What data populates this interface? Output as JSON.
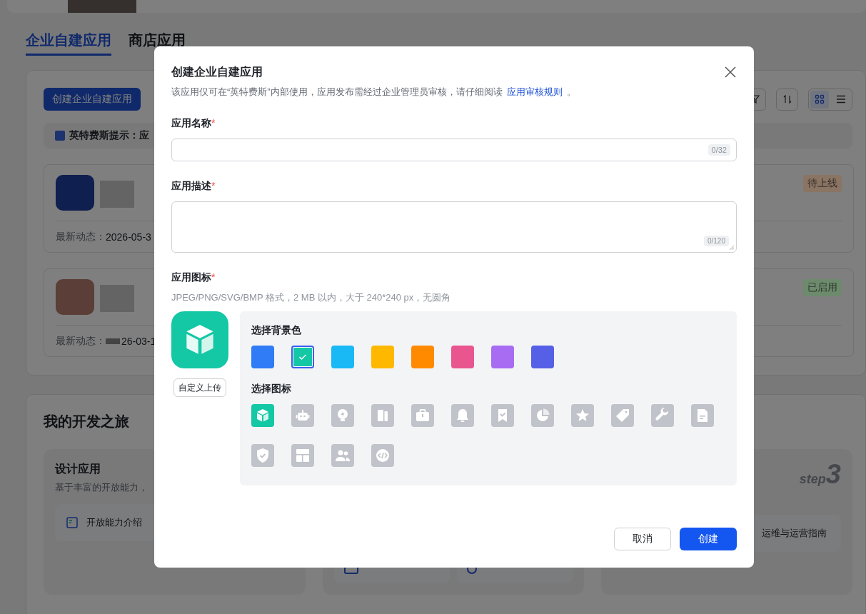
{
  "page": {
    "tabs": [
      {
        "label": "企业自建应用",
        "selected": true
      },
      {
        "label": "商店应用",
        "selected": false
      }
    ],
    "create_button": "创建企业自建应用",
    "view_modes": [
      {
        "selected": true
      },
      {
        "selected": false
      }
    ],
    "notice": "英特费斯提示：应",
    "apps": [
      {
        "status": "待上线",
        "color": "#8a7464",
        "activity_label": "最新动态：",
        "activity_time": "2026-05-3",
        "time_partly_blurred": false
      },
      {
        "status": "已启用",
        "color": "#6d8a6d",
        "activity_label": "最新动态：",
        "activity_time": "26-03-1",
        "time_partly_blurred": true
      }
    ],
    "journey": {
      "title": "我的开发之旅",
      "steps": [
        {
          "title": "设计应用",
          "description": "基于丰富的开放能力，",
          "link": "开放能力介绍",
          "covered": false
        },
        {
          "covered": true
        },
        {
          "step_label": "step",
          "step_number": "3",
          "link": "运维与运营指南",
          "covered": false
        }
      ]
    }
  },
  "dialog": {
    "title": "创建企业自建应用",
    "intro": "该应用仅可在“英特费斯”内部使用，应用发布需经过企业管理员审核，请仔细阅读",
    "intro_link": "应用审核规则",
    "intro_end": "。",
    "name_field": {
      "label": "应用名称",
      "required_mark": "*",
      "counter": "0/32"
    },
    "description_field": {
      "label": "应用描述",
      "required_mark": "*",
      "counter": "0/120"
    },
    "icon_field": {
      "label": "应用图标",
      "required_mark": "*",
      "hint": "JPEG/PNG/SVG/BMP 格式，2 MB 以内，大于 240*240 px，无圆角",
      "upload_button": "自定义上传",
      "bg_heading": "选择背景色",
      "colors": [
        {
          "color": "#2f7cf6",
          "selected": false
        },
        {
          "color": "#14c7a5",
          "selected": true
        },
        {
          "color": "#19b9f6",
          "selected": false
        },
        {
          "color": "#ffb800",
          "selected": false
        },
        {
          "color": "#ff8a00",
          "selected": false
        },
        {
          "color": "#e9558e",
          "selected": false
        },
        {
          "color": "#a86cf3",
          "selected": false
        },
        {
          "color": "#5660e6",
          "selected": false
        }
      ],
      "icon_heading": "选择图标",
      "icons": [
        {
          "selected": true
        },
        {
          "selected": false
        },
        {
          "selected": false
        },
        {
          "selected": false
        },
        {
          "selected": false
        },
        {
          "selected": false
        },
        {
          "selected": false
        },
        {
          "selected": false
        },
        {
          "selected": false
        },
        {
          "selected": false
        },
        {
          "selected": false
        },
        {
          "selected": false
        },
        {
          "selected": false
        },
        {
          "selected": false
        },
        {
          "selected": false
        },
        {
          "selected": false
        }
      ]
    },
    "cancel_button": "取消",
    "create_button": "创建"
  }
}
